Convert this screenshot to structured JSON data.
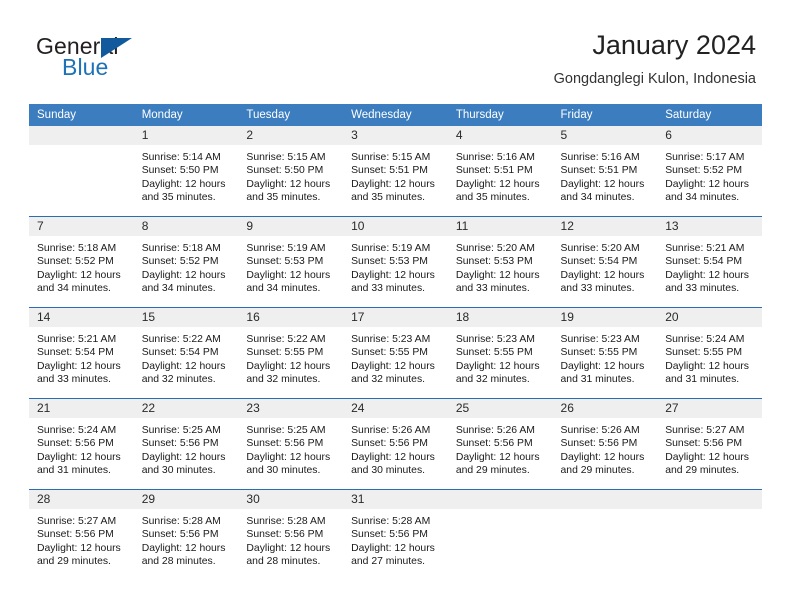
{
  "brand": {
    "name_part1": "General",
    "name_part2": "Blue",
    "triangle_color": "#125a9c",
    "blue_color": "#1d72b8"
  },
  "header": {
    "title": "January 2024",
    "subtitle": "Gongdanglegi Kulon, Indonesia"
  },
  "theme": {
    "header_bar_color": "#3b7dbf",
    "week_separator_color": "#2a6db5",
    "daynum_band_color": "#efefef"
  },
  "calendar": {
    "weekday_headers": [
      "Sunday",
      "Monday",
      "Tuesday",
      "Wednesday",
      "Thursday",
      "Friday",
      "Saturday"
    ],
    "weeks": [
      [
        {
          "day": "",
          "empty": true,
          "sunrise": "",
          "sunset": "",
          "daylight_line1": "",
          "daylight_line2": ""
        },
        {
          "day": "1",
          "empty": false,
          "sunrise": "Sunrise: 5:14 AM",
          "sunset": "Sunset: 5:50 PM",
          "daylight_line1": "Daylight: 12 hours",
          "daylight_line2": "and 35 minutes."
        },
        {
          "day": "2",
          "empty": false,
          "sunrise": "Sunrise: 5:15 AM",
          "sunset": "Sunset: 5:50 PM",
          "daylight_line1": "Daylight: 12 hours",
          "daylight_line2": "and 35 minutes."
        },
        {
          "day": "3",
          "empty": false,
          "sunrise": "Sunrise: 5:15 AM",
          "sunset": "Sunset: 5:51 PM",
          "daylight_line1": "Daylight: 12 hours",
          "daylight_line2": "and 35 minutes."
        },
        {
          "day": "4",
          "empty": false,
          "sunrise": "Sunrise: 5:16 AM",
          "sunset": "Sunset: 5:51 PM",
          "daylight_line1": "Daylight: 12 hours",
          "daylight_line2": "and 35 minutes."
        },
        {
          "day": "5",
          "empty": false,
          "sunrise": "Sunrise: 5:16 AM",
          "sunset": "Sunset: 5:51 PM",
          "daylight_line1": "Daylight: 12 hours",
          "daylight_line2": "and 34 minutes."
        },
        {
          "day": "6",
          "empty": false,
          "sunrise": "Sunrise: 5:17 AM",
          "sunset": "Sunset: 5:52 PM",
          "daylight_line1": "Daylight: 12 hours",
          "daylight_line2": "and 34 minutes."
        }
      ],
      [
        {
          "day": "7",
          "empty": false,
          "sunrise": "Sunrise: 5:18 AM",
          "sunset": "Sunset: 5:52 PM",
          "daylight_line1": "Daylight: 12 hours",
          "daylight_line2": "and 34 minutes."
        },
        {
          "day": "8",
          "empty": false,
          "sunrise": "Sunrise: 5:18 AM",
          "sunset": "Sunset: 5:52 PM",
          "daylight_line1": "Daylight: 12 hours",
          "daylight_line2": "and 34 minutes."
        },
        {
          "day": "9",
          "empty": false,
          "sunrise": "Sunrise: 5:19 AM",
          "sunset": "Sunset: 5:53 PM",
          "daylight_line1": "Daylight: 12 hours",
          "daylight_line2": "and 34 minutes."
        },
        {
          "day": "10",
          "empty": false,
          "sunrise": "Sunrise: 5:19 AM",
          "sunset": "Sunset: 5:53 PM",
          "daylight_line1": "Daylight: 12 hours",
          "daylight_line2": "and 33 minutes."
        },
        {
          "day": "11",
          "empty": false,
          "sunrise": "Sunrise: 5:20 AM",
          "sunset": "Sunset: 5:53 PM",
          "daylight_line1": "Daylight: 12 hours",
          "daylight_line2": "and 33 minutes."
        },
        {
          "day": "12",
          "empty": false,
          "sunrise": "Sunrise: 5:20 AM",
          "sunset": "Sunset: 5:54 PM",
          "daylight_line1": "Daylight: 12 hours",
          "daylight_line2": "and 33 minutes."
        },
        {
          "day": "13",
          "empty": false,
          "sunrise": "Sunrise: 5:21 AM",
          "sunset": "Sunset: 5:54 PM",
          "daylight_line1": "Daylight: 12 hours",
          "daylight_line2": "and 33 minutes."
        }
      ],
      [
        {
          "day": "14",
          "empty": false,
          "sunrise": "Sunrise: 5:21 AM",
          "sunset": "Sunset: 5:54 PM",
          "daylight_line1": "Daylight: 12 hours",
          "daylight_line2": "and 33 minutes."
        },
        {
          "day": "15",
          "empty": false,
          "sunrise": "Sunrise: 5:22 AM",
          "sunset": "Sunset: 5:54 PM",
          "daylight_line1": "Daylight: 12 hours",
          "daylight_line2": "and 32 minutes."
        },
        {
          "day": "16",
          "empty": false,
          "sunrise": "Sunrise: 5:22 AM",
          "sunset": "Sunset: 5:55 PM",
          "daylight_line1": "Daylight: 12 hours",
          "daylight_line2": "and 32 minutes."
        },
        {
          "day": "17",
          "empty": false,
          "sunrise": "Sunrise: 5:23 AM",
          "sunset": "Sunset: 5:55 PM",
          "daylight_line1": "Daylight: 12 hours",
          "daylight_line2": "and 32 minutes."
        },
        {
          "day": "18",
          "empty": false,
          "sunrise": "Sunrise: 5:23 AM",
          "sunset": "Sunset: 5:55 PM",
          "daylight_line1": "Daylight: 12 hours",
          "daylight_line2": "and 32 minutes."
        },
        {
          "day": "19",
          "empty": false,
          "sunrise": "Sunrise: 5:23 AM",
          "sunset": "Sunset: 5:55 PM",
          "daylight_line1": "Daylight: 12 hours",
          "daylight_line2": "and 31 minutes."
        },
        {
          "day": "20",
          "empty": false,
          "sunrise": "Sunrise: 5:24 AM",
          "sunset": "Sunset: 5:55 PM",
          "daylight_line1": "Daylight: 12 hours",
          "daylight_line2": "and 31 minutes."
        }
      ],
      [
        {
          "day": "21",
          "empty": false,
          "sunrise": "Sunrise: 5:24 AM",
          "sunset": "Sunset: 5:56 PM",
          "daylight_line1": "Daylight: 12 hours",
          "daylight_line2": "and 31 minutes."
        },
        {
          "day": "22",
          "empty": false,
          "sunrise": "Sunrise: 5:25 AM",
          "sunset": "Sunset: 5:56 PM",
          "daylight_line1": "Daylight: 12 hours",
          "daylight_line2": "and 30 minutes."
        },
        {
          "day": "23",
          "empty": false,
          "sunrise": "Sunrise: 5:25 AM",
          "sunset": "Sunset: 5:56 PM",
          "daylight_line1": "Daylight: 12 hours",
          "daylight_line2": "and 30 minutes."
        },
        {
          "day": "24",
          "empty": false,
          "sunrise": "Sunrise: 5:26 AM",
          "sunset": "Sunset: 5:56 PM",
          "daylight_line1": "Daylight: 12 hours",
          "daylight_line2": "and 30 minutes."
        },
        {
          "day": "25",
          "empty": false,
          "sunrise": "Sunrise: 5:26 AM",
          "sunset": "Sunset: 5:56 PM",
          "daylight_line1": "Daylight: 12 hours",
          "daylight_line2": "and 29 minutes."
        },
        {
          "day": "26",
          "empty": false,
          "sunrise": "Sunrise: 5:26 AM",
          "sunset": "Sunset: 5:56 PM",
          "daylight_line1": "Daylight: 12 hours",
          "daylight_line2": "and 29 minutes."
        },
        {
          "day": "27",
          "empty": false,
          "sunrise": "Sunrise: 5:27 AM",
          "sunset": "Sunset: 5:56 PM",
          "daylight_line1": "Daylight: 12 hours",
          "daylight_line2": "and 29 minutes."
        }
      ],
      [
        {
          "day": "28",
          "empty": false,
          "sunrise": "Sunrise: 5:27 AM",
          "sunset": "Sunset: 5:56 PM",
          "daylight_line1": "Daylight: 12 hours",
          "daylight_line2": "and 29 minutes."
        },
        {
          "day": "29",
          "empty": false,
          "sunrise": "Sunrise: 5:28 AM",
          "sunset": "Sunset: 5:56 PM",
          "daylight_line1": "Daylight: 12 hours",
          "daylight_line2": "and 28 minutes."
        },
        {
          "day": "30",
          "empty": false,
          "sunrise": "Sunrise: 5:28 AM",
          "sunset": "Sunset: 5:56 PM",
          "daylight_line1": "Daylight: 12 hours",
          "daylight_line2": "and 28 minutes."
        },
        {
          "day": "31",
          "empty": false,
          "sunrise": "Sunrise: 5:28 AM",
          "sunset": "Sunset: 5:56 PM",
          "daylight_line1": "Daylight: 12 hours",
          "daylight_line2": "and 27 minutes."
        },
        {
          "day": "",
          "empty": true,
          "sunrise": "",
          "sunset": "",
          "daylight_line1": "",
          "daylight_line2": ""
        },
        {
          "day": "",
          "empty": true,
          "sunrise": "",
          "sunset": "",
          "daylight_line1": "",
          "daylight_line2": ""
        },
        {
          "day": "",
          "empty": true,
          "sunrise": "",
          "sunset": "",
          "daylight_line1": "",
          "daylight_line2": ""
        }
      ]
    ]
  }
}
